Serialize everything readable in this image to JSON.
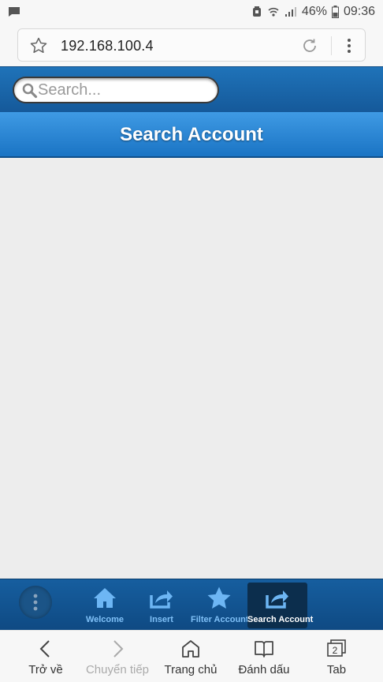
{
  "status_bar": {
    "battery_percent": "46%",
    "time": "09:36",
    "icons": [
      "chat-icon",
      "alarm-icon",
      "wifi-icon",
      "signal-icon",
      "battery-icon"
    ]
  },
  "browser": {
    "url": "192.168.100.4"
  },
  "search": {
    "placeholder": "Search..."
  },
  "header": {
    "title": "Search Account"
  },
  "footer_nav": {
    "items": [
      {
        "label": "Welcome",
        "icon": "home-icon"
      },
      {
        "label": "Insert",
        "icon": "share-icon"
      },
      {
        "label": "Filter Account",
        "icon": "star-icon"
      },
      {
        "label": "Search Account",
        "icon": "share-icon",
        "active": true
      }
    ]
  },
  "browser_toolbar": {
    "back": "Trở về",
    "forward": "Chuyển tiếp",
    "home": "Trang chủ",
    "bookmarks": "Đánh dấu",
    "tabs": "Tab",
    "tab_count": "2"
  },
  "colors": {
    "header_blue": "#1a74c4",
    "footer_blue": "#0f4a83",
    "active_tab": "#0c2e4d",
    "nav_label": "#7fc0f7"
  }
}
